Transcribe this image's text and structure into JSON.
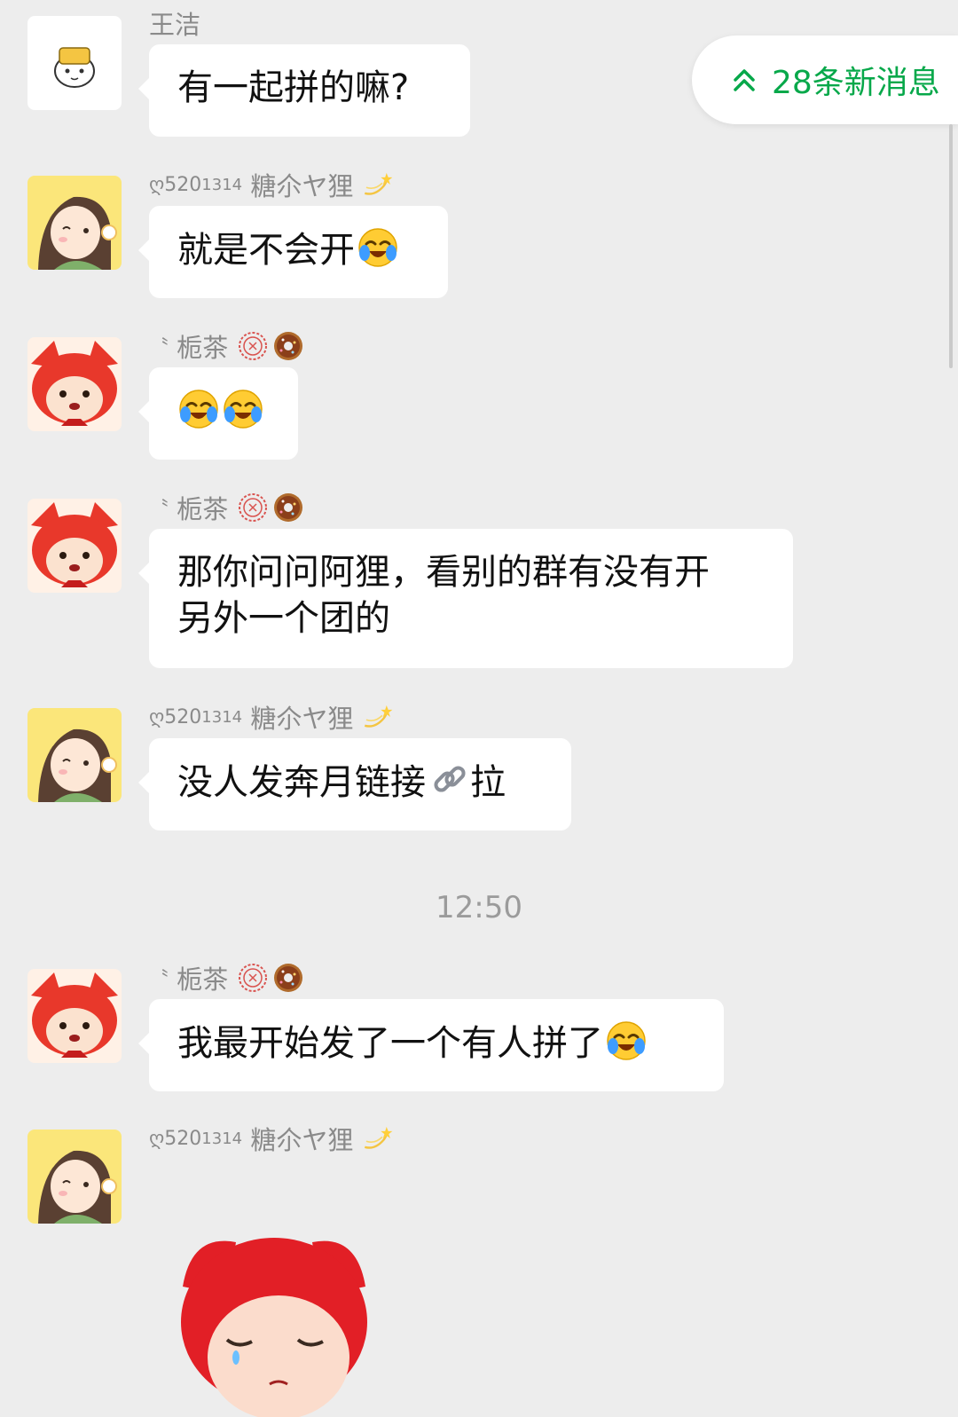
{
  "new_messages": {
    "label": "28条新消息"
  },
  "time_divider": "12:50",
  "senders": {
    "wangjie": "王洁",
    "tang_prefix": "ღ520",
    "tang_sup": "1314",
    "tang_name": "糖尒ヤ狸",
    "zhicha_prefix": "〝",
    "zhicha_name": "栀茶"
  },
  "messages": [
    {
      "text": "有一起拼的嘛?"
    },
    {
      "text": "就是不会开"
    },
    {
      "text": ""
    },
    {
      "text_line1": "那你问问阿狸，看别的群有没有开",
      "text_line2": "另外一个团的"
    },
    {
      "text_before": "没人发奔月链接",
      "text_after": "拉"
    },
    {
      "text": "我最开始发了一个有人拼了"
    }
  ],
  "colors": {
    "background": "#ededed",
    "bubble": "#ffffff",
    "accent_green": "#07a84a",
    "sender_gray": "#8a8a8a"
  },
  "icons": [
    "crying-laughing-emoji",
    "link-emoji",
    "donut-emoji",
    "stamp-icon",
    "shooting-star-icon",
    "double-chevron-up-icon"
  ]
}
